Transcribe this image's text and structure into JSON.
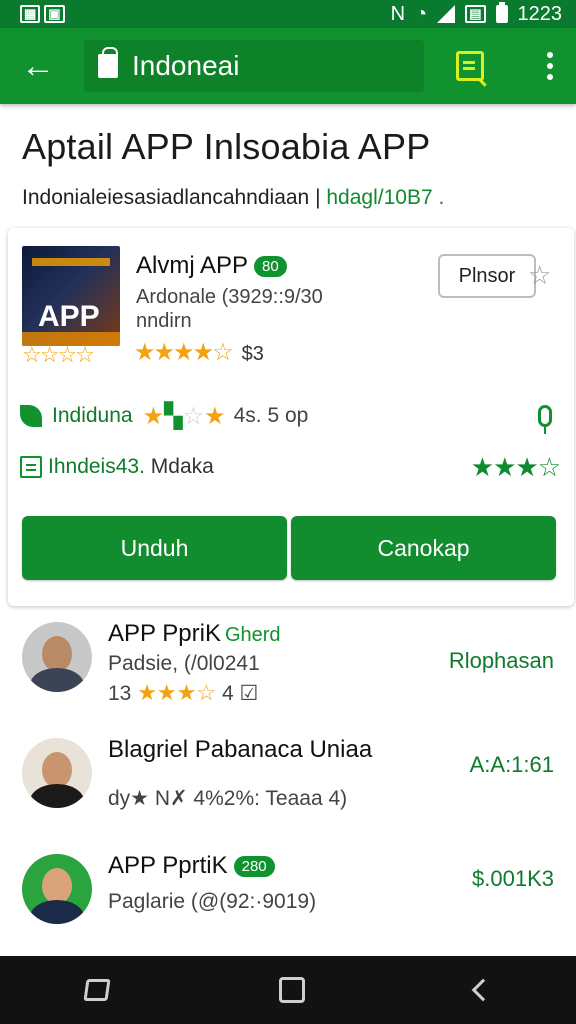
{
  "status_bar": {
    "left_icon_text": "N",
    "time": "1223"
  },
  "app_bar": {
    "back_icon": "arrow-left-icon",
    "search_value": "Indoneai",
    "scan_icon": "scan-icon",
    "more_icon": "more-vert-icon"
  },
  "header": {
    "title": "Aptail APP Inlsoabia APP",
    "subtitle": "Indonialeiesasiadlancahndiaan |",
    "subtitle_accent": "hdagl/10B7 ."
  },
  "app_card": {
    "thumb_text": "APP",
    "name": "Alvmj APP",
    "badge": "80",
    "meta1": "Ardonale (3929::9/30",
    "meta2": "nndirn",
    "stars_hollow": "☆☆☆☆",
    "rating_stars": "★★★★☆",
    "rating_count": "$3",
    "plus_button": "Plnsor",
    "feature_text": "Indiduna",
    "feature_meta": "4s. 5 op",
    "info_text": "Ihndeis43.",
    "info_text2": "Mdaka",
    "info_stars": "★★★☆",
    "btn_primary": "Unduh",
    "btn_secondary": "Canokap"
  },
  "list": {
    "items": [
      {
        "title": "APP PpriK",
        "tag": "Gherd",
        "sub": "Padsie, (/0l0241",
        "sub2_prefix": "13",
        "sub2_stars": "★★★☆",
        "sub2_suffix": "4",
        "right": "Rlophasan"
      },
      {
        "title": "Blagriel Pabanaca Uniaa",
        "sub": "dy★ N✗ 4%2%: Teaaa 4)",
        "right": "A:A:1:61"
      },
      {
        "title": "APP PprtiK",
        "tag": "280",
        "sub": "Paglarie (@(92:·9019)",
        "right": "$.001K3"
      }
    ]
  },
  "colors": {
    "primary": "#10922f",
    "status_bar": "#0a7a2f",
    "star": "#f3a312",
    "scan_accent": "#d9f020"
  }
}
